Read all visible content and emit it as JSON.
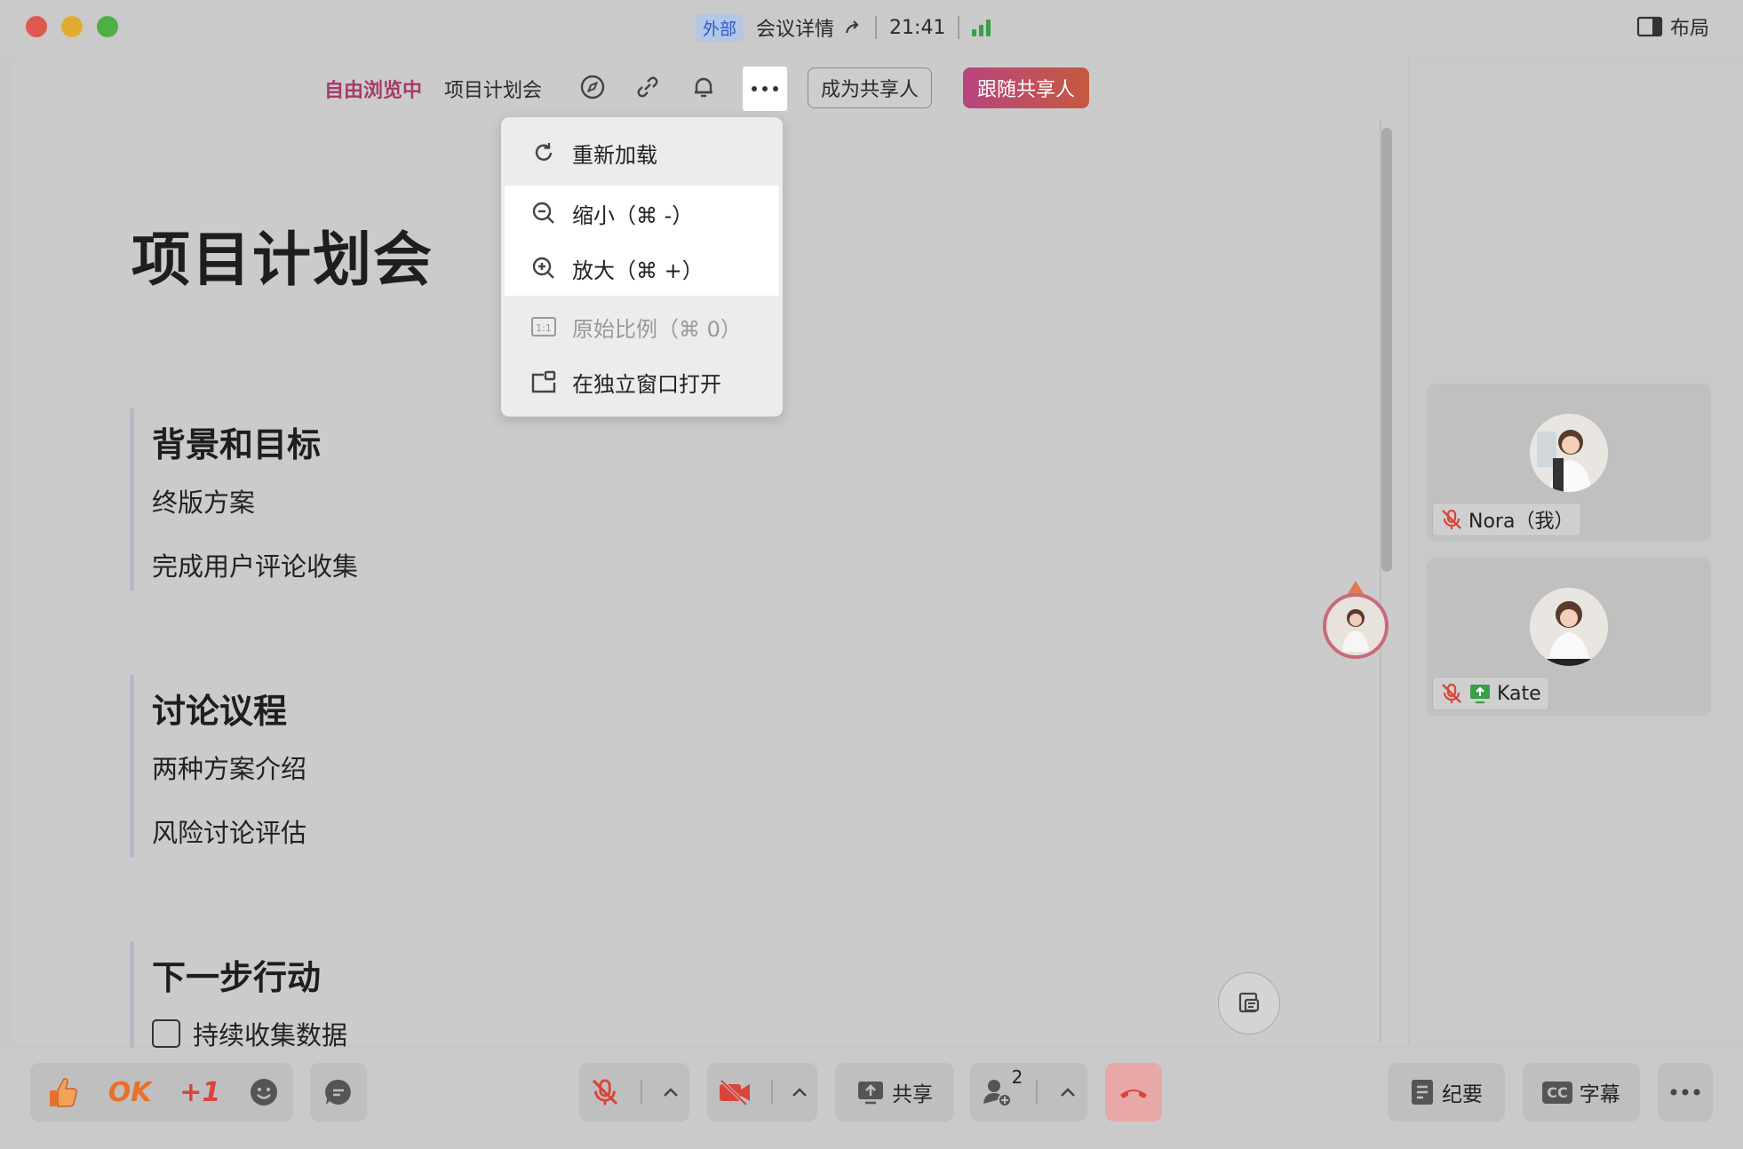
{
  "titlebar": {
    "badge": "外部",
    "meeting_details": "会议详情",
    "time": "21:41",
    "layout_label": "布局"
  },
  "toolbar": {
    "browse_status": "自由浏览中",
    "doc_name": "项目计划会",
    "become_presenter": "成为共享人",
    "follow_presenter": "跟随共享人"
  },
  "menu": {
    "items": [
      {
        "label": "重新加载",
        "icon": "reload-icon",
        "highlighted": false,
        "disabled": false
      },
      {
        "label": "缩小（⌘ -）",
        "icon": "zoom-out-icon",
        "highlighted": true,
        "disabled": false
      },
      {
        "label": "放大（⌘ +）",
        "icon": "zoom-in-icon",
        "highlighted": true,
        "disabled": false
      },
      {
        "label": "原始比例（⌘ 0）",
        "icon": "actual-size-icon",
        "highlighted": false,
        "disabled": true
      },
      {
        "label": "在独立窗口打开",
        "icon": "open-window-icon",
        "highlighted": false,
        "disabled": false
      }
    ]
  },
  "document": {
    "title": "项目计划会",
    "sections": [
      {
        "heading": "背景和目标",
        "items": [
          "终版方案",
          "完成用户评论收集"
        ]
      },
      {
        "heading": "讨论议程",
        "items": [
          "两种方案介绍",
          "风险讨论评估"
        ]
      },
      {
        "heading": "下一步行动",
        "checklist": [
          "持续收集数据"
        ]
      }
    ]
  },
  "participants": [
    {
      "name": "Nora（我）",
      "muted": true,
      "sharing": false
    },
    {
      "name": "Kate",
      "muted": true,
      "sharing": true
    }
  ],
  "bottombar": {
    "reaction_ok": "OK",
    "reaction_plus": "+1",
    "share": "共享",
    "participant_count": "2",
    "minutes": "纪要",
    "captions": "字幕",
    "captions_badge": "CC"
  },
  "colors": {
    "accent_pink": "#a8396a",
    "follow_gradient_start": "#b7457e",
    "follow_gradient_end": "#c5593f",
    "external_badge_bg": "#b3c6e6",
    "mute_red": "#d9453a",
    "share_green": "#3b9e48",
    "hangup_bg": "#e8a8a8"
  }
}
